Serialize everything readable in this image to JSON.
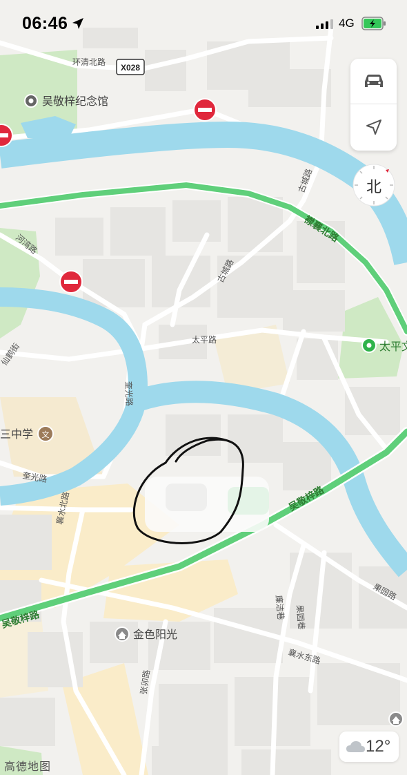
{
  "status_bar": {
    "time": "06:46",
    "network": "4G"
  },
  "map": {
    "roads": {
      "huanqing_north": "环清北路",
      "x028": "X028",
      "gucheng_1": "古城路",
      "gucheng_2": "古城路",
      "jinxiang_north": "襟襄北路",
      "hewan": "河湾路",
      "taiping": "太平路",
      "xianhe": "仙鹤街",
      "kuiguang_1": "奎光路",
      "kuiguang_2": "奎光路",
      "wujingzi_east": "吴敬梓路",
      "wujingzi_west": "吴敬梓路",
      "xiangshui_north": "襄水北路",
      "xiangshui_east": "襄水东路",
      "lianjie": "廉洁巷",
      "guoyuan_1": "果园巷",
      "guoyuan_2": "果园路",
      "zhangmao": "张卯路"
    },
    "pois": {
      "memorial": "吴敬梓纪念馆",
      "taiping_short": "太平文",
      "school": "三中学",
      "community": "金色阳光"
    }
  },
  "controls": {
    "compass_label": "北"
  },
  "weather": {
    "temperature": "12°"
  },
  "logo": "高德地图",
  "colors": {
    "water": "#9ed9ec",
    "green_road": "#5fcf7a",
    "park": "#cfe9c4",
    "block": "#e6e5e2",
    "warm_area": "#faecc9",
    "restriction": "#e0283c"
  }
}
